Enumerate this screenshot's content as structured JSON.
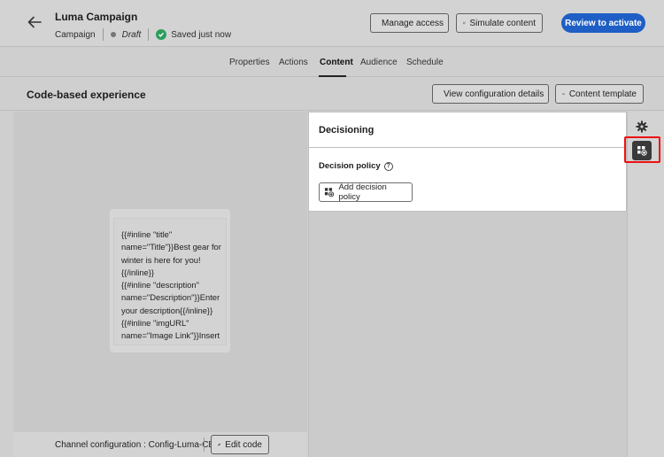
{
  "header": {
    "title": "Luma Campaign",
    "type": "Campaign",
    "status": "Draft",
    "save_state": "Saved just now",
    "manage_access": "Manage access",
    "simulate_content": "Simulate content",
    "review": "Review to activate"
  },
  "tabs": [
    {
      "label": "Properties"
    },
    {
      "label": "Actions"
    },
    {
      "label": "Content",
      "active": true
    },
    {
      "label": "Audience"
    },
    {
      "label": "Schedule"
    }
  ],
  "section": {
    "title": "Code-based experience",
    "view_config": "View configuration details",
    "content_template": "Content template"
  },
  "preview": {
    "code_lines": "{{#inline \"title\"\nname=\"Title\"}}Best gear for\nwinter is here for you!\n{{/inline}}\n{{#inline \"description\"\nname=\"Description\"}}Enter\nyour description{{/inline}}\n{{#inline \"imgURL\"\nname=\"Image Link\"}}Insert"
  },
  "footer": {
    "channel": "Channel configuration : Config-Luma-CBE",
    "edit_code": "Edit code"
  },
  "decisioning": {
    "title": "Decisioning",
    "policy_label": "Decision policy",
    "add_policy": "Add decision policy"
  },
  "colors": {
    "primary": "#1f5fc5",
    "saved_check": "#2d9d5c",
    "highlight": "#e11111"
  }
}
